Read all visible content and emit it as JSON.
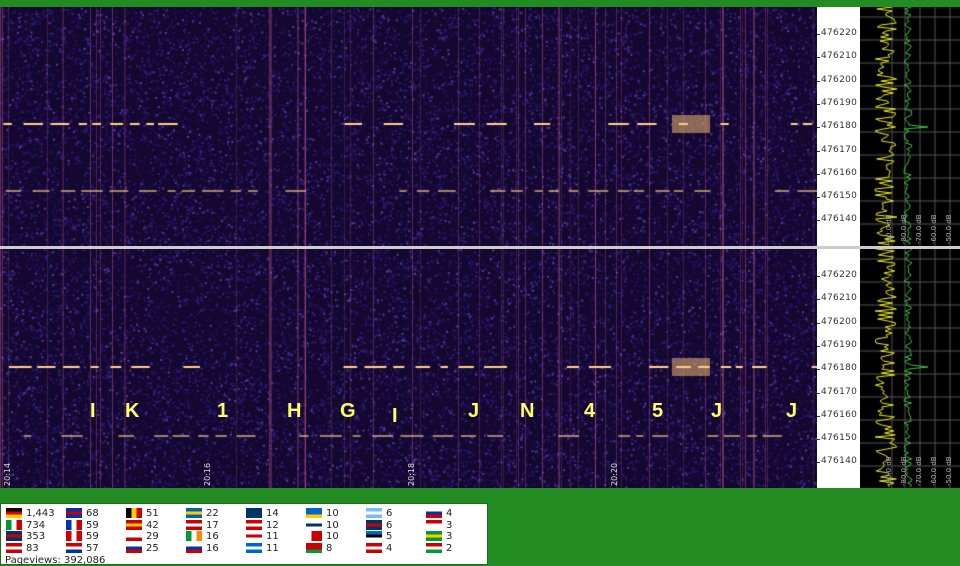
{
  "spectrogram": {
    "freq_labels": [
      "476220",
      "476210",
      "476200",
      "476190",
      "476180",
      "476170",
      "476160",
      "476150",
      "476140"
    ],
    "time_labels": [
      "20:14",
      "20:16",
      "20:18",
      "20:20"
    ],
    "db_labels": [
      "-90.0 dB",
      "-80.0 dB",
      "-70.0 dB",
      "-60.0 dB",
      "-50.0 dB"
    ],
    "letters": [
      "I",
      "K",
      "1",
      "H",
      "G",
      "I",
      "J",
      "N",
      "4",
      "5",
      "J",
      "J"
    ],
    "colors": {
      "background": "#1a0a3a",
      "signal": "#ffd080",
      "trace_yellow": "#e8e820",
      "trace_green": "#40c040"
    }
  },
  "flag_counter": {
    "entries": [
      {
        "flag": "de",
        "count": "1,443"
      },
      {
        "flag": "it",
        "count": "734"
      },
      {
        "flag": "gb",
        "count": "353"
      },
      {
        "flag": "us",
        "count": "83"
      },
      {
        "flag": "is",
        "count": "68"
      },
      {
        "flag": "fr",
        "count": "59"
      },
      {
        "flag": "ca",
        "count": "59"
      },
      {
        "flag": "nl",
        "count": "57"
      },
      {
        "flag": "be",
        "count": "51"
      },
      {
        "flag": "es",
        "count": "42"
      },
      {
        "flag": "pl",
        "count": "29"
      },
      {
        "flag": "ru",
        "count": "25"
      },
      {
        "flag": "se",
        "count": "22"
      },
      {
        "flag": "no",
        "count": "17"
      },
      {
        "flag": "ie",
        "count": "16"
      },
      {
        "flag": "si",
        "count": "16"
      },
      {
        "flag": "au",
        "count": "14"
      },
      {
        "flag": "ch",
        "count": "12"
      },
      {
        "flag": "jp",
        "count": "11"
      },
      {
        "flag": "gr",
        "count": "11"
      },
      {
        "flag": "ua",
        "count": "10"
      },
      {
        "flag": "fi",
        "count": "10"
      },
      {
        "flag": "mt",
        "count": "10"
      },
      {
        "flag": "by",
        "count": "8"
      },
      {
        "flag": "ar",
        "count": "6"
      },
      {
        "flag": "nz",
        "count": "6"
      },
      {
        "flag": "ee",
        "count": "5"
      },
      {
        "flag": "at",
        "count": "4"
      },
      {
        "flag": "cz",
        "count": "4"
      },
      {
        "flag": "id",
        "count": "3"
      },
      {
        "flag": "br",
        "count": "3"
      },
      {
        "flag": "hu",
        "count": "2"
      }
    ],
    "pageviews": "Pageviews: 392,086"
  }
}
